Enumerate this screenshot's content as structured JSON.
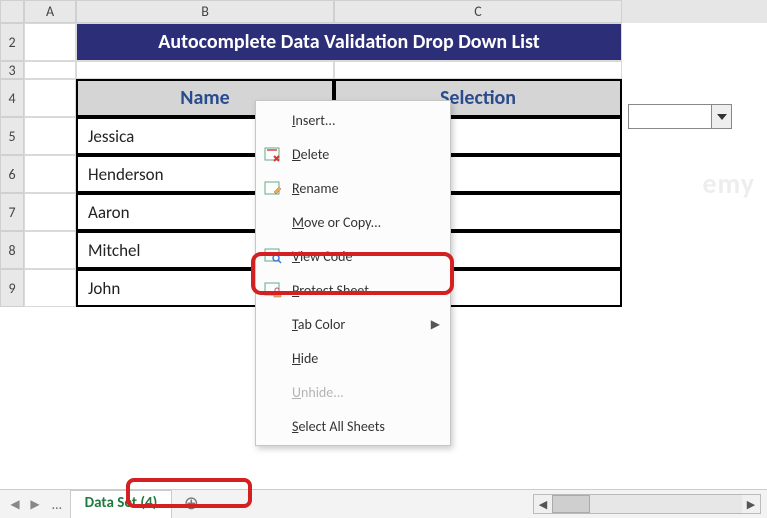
{
  "columns": {
    "A": "A",
    "B": "B",
    "C": "C"
  },
  "rows": [
    "2",
    "3",
    "4",
    "5",
    "6",
    "7",
    "8",
    "9"
  ],
  "title": "Autocomplete Data Validation Drop Down List",
  "headers": {
    "name": "Name",
    "selection": "Selection"
  },
  "names": [
    "Jessica",
    "Henderson",
    "Aaron",
    "Mitchel",
    "John"
  ],
  "menu": {
    "insert": "Insert...",
    "delete": "Delete",
    "rename": "Rename",
    "move": "Move or Copy...",
    "viewcode": "View Code",
    "protect": "Protect Sheet...",
    "tabcolor": "Tab Color",
    "hide": "Hide",
    "unhide": "Unhide...",
    "selectall": "Select All Sheets"
  },
  "tab": "Data Set (4)",
  "watermark": "emy"
}
